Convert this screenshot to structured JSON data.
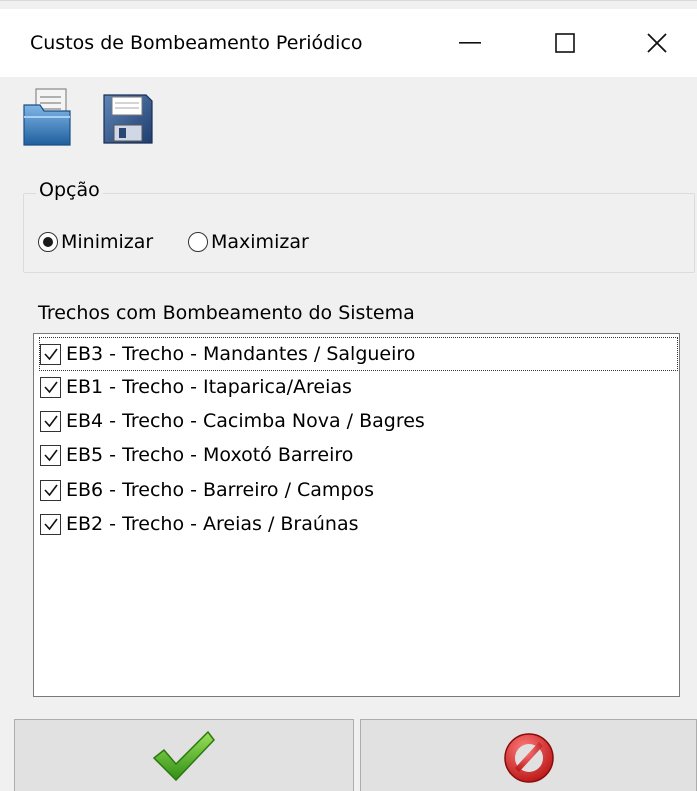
{
  "window": {
    "title": "Custos de Bombeamento Periódico"
  },
  "toolbar": {
    "open_icon": "open-folder-icon",
    "save_icon": "floppy-save-icon"
  },
  "option": {
    "legend": "Opção",
    "choices": [
      {
        "label": "Minimizar",
        "selected": true
      },
      {
        "label": "Maximizar",
        "selected": false
      }
    ]
  },
  "trechos": {
    "legend": "Trechos com Bombeamento do Sistema",
    "items": [
      {
        "label": "EB3 - Trecho - Mandantes / Salgueiro",
        "checked": true
      },
      {
        "label": "EB1 - Trecho - Itaparica/Areias",
        "checked": true
      },
      {
        "label": "EB4 - Trecho - Cacimba Nova / Bagres",
        "checked": true
      },
      {
        "label": "EB5 - Trecho - Moxotó Barreiro",
        "checked": true
      },
      {
        "label": "EB6 - Trecho - Barreiro / Campos",
        "checked": true
      },
      {
        "label": "EB2 - Trecho - Areias / Braúnas",
        "checked": true
      }
    ]
  },
  "buttons": {
    "ok_icon": "green-check-icon",
    "cancel_icon": "red-forbidden-icon"
  },
  "colors": {
    "ok_green": "#4caf1e",
    "cancel_red": "#d42020"
  }
}
